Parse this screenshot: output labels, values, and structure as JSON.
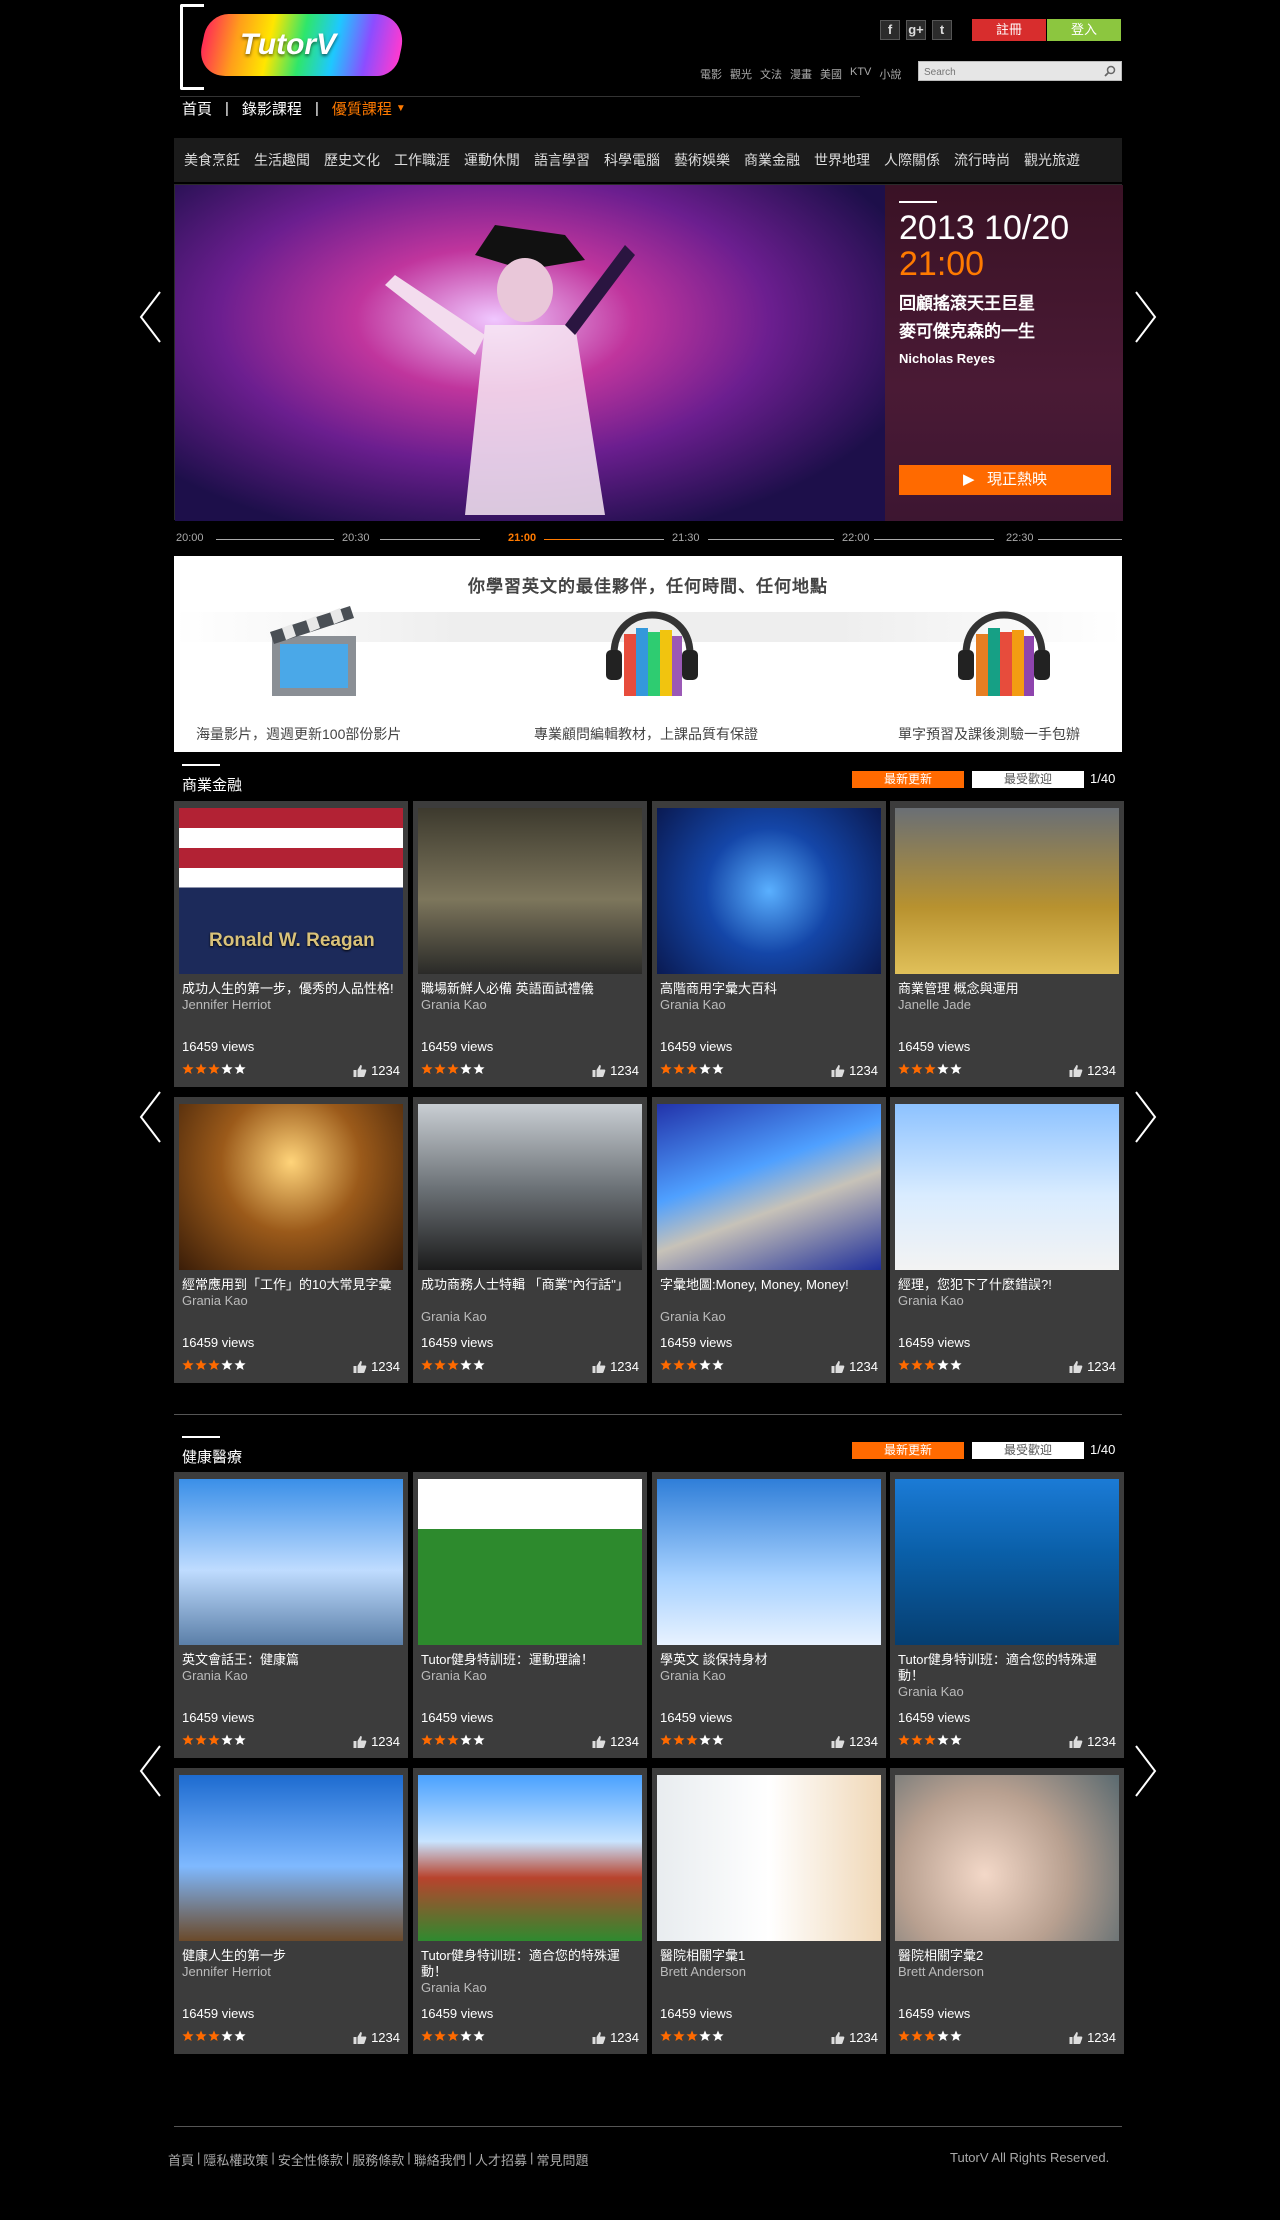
{
  "brand": {
    "logo_text": "TutorV"
  },
  "header": {
    "social": [
      "f",
      "g+",
      "t"
    ],
    "register_label": "註冊",
    "login_label": "登入",
    "quick_links": [
      "電影",
      "觀光",
      "文法",
      "漫畫",
      "美國",
      "KTV",
      "小說"
    ],
    "search_placeholder": "Search"
  },
  "nav": {
    "items": [
      "首頁",
      "錄影課程",
      "優質課程"
    ]
  },
  "categories": [
    "美食烹飪",
    "生活趣聞",
    "歷史文化",
    "工作職涯",
    "運動休閒",
    "語言學習",
    "科學電腦",
    "藝術娛樂",
    "商業金融",
    "世界地理",
    "人際關係",
    "流行時尚",
    "觀光旅遊"
  ],
  "hero": {
    "date": "2013 10/20",
    "time": "21:00",
    "title_line1": "回顧搖滾天王巨星",
    "title_line2": "麥可傑克森的一生",
    "author": "Nicholas Reyes",
    "play_label": "現正熱映"
  },
  "timeline": [
    "20:00",
    "20:30",
    "21:00",
    "21:30",
    "22:00",
    "22:30"
  ],
  "banner": {
    "headline": "你學習英文的最佳夥伴，任何時間、任何地點",
    "captions": [
      "海量影片，週週更新100部份影片",
      "專業顧問編輯教材，上課品質有保證",
      "單字預習及課後測驗一手包辦"
    ]
  },
  "sections": [
    {
      "title": "商業金融",
      "tab_new": "最新更新",
      "tab_popular": "最受歡迎",
      "pager": "1/40",
      "cards": [
        {
          "title": "成功人生的第一步，優秀的人品性格!",
          "author": "Jennifer Herriot",
          "views": "16459 views",
          "likes": "1234",
          "thumb_text": "Ronald W. Reagan"
        },
        {
          "title": "職場新鮮人必備 英語面試禮儀",
          "author": "Grania Kao",
          "views": "16459 views",
          "likes": "1234"
        },
        {
          "title": "高階商用字彙大百科",
          "author": "Grania Kao",
          "views": "16459 views",
          "likes": "1234"
        },
        {
          "title": "商業管理 概念與運用",
          "author": "Janelle Jade",
          "views": "16459 views",
          "likes": "1234"
        },
        {
          "title": "經常應用到「工作」的10大常見字彙",
          "author": "Grania Kao",
          "views": "16459 views",
          "likes": "1234"
        },
        {
          "title": "成功商務人士特輯 「商業\"內行話\"」",
          "author": "Grania Kao",
          "views": "16459 views",
          "likes": "1234"
        },
        {
          "title": "字彙地圖:Money, Money, Money!",
          "author": "Grania Kao",
          "views": "16459 views",
          "likes": "1234"
        },
        {
          "title": "經理，您犯下了什麼錯誤?!",
          "author": "Grania Kao",
          "views": "16459 views",
          "likes": "1234"
        }
      ]
    },
    {
      "title": "健康醫療",
      "tab_new": "最新更新",
      "tab_popular": "最受歡迎",
      "pager": "1/40",
      "cards": [
        {
          "title": "英文會話王：健康篇",
          "author": "Grania Kao",
          "views": "16459 views",
          "likes": "1234"
        },
        {
          "title": "Tutor健身特訓班：運動理論！",
          "author": "Grania Kao",
          "views": "16459 views",
          "likes": "1234"
        },
        {
          "title": "學英文 談保持身材",
          "author": "Grania Kao",
          "views": "16459 views",
          "likes": "1234"
        },
        {
          "title": "Tutor健身特训班：適合您的特殊運動！",
          "author": "Grania Kao",
          "views": "16459 views",
          "likes": "1234"
        },
        {
          "title": "健康人生的第一步",
          "author": "Jennifer Herriot",
          "views": "16459 views",
          "likes": "1234"
        },
        {
          "title": "Tutor健身特训班：適合您的特殊運動！",
          "author": "Grania Kao",
          "views": "16459 views",
          "likes": "1234"
        },
        {
          "title": "醫院相關字彙1",
          "author": "Brett Anderson",
          "views": "16459 views",
          "likes": "1234"
        },
        {
          "title": "醫院相關字彙2",
          "author": "Brett Anderson",
          "views": "16459 views",
          "likes": "1234"
        }
      ]
    }
  ],
  "footer": {
    "links": [
      "首頁",
      "隱私權政策",
      "安全性條款",
      "服務條款",
      "聯絡我們",
      "人才招募",
      "常見問題"
    ],
    "copyright": "TutorV All Rights Reserved."
  },
  "colors": {
    "accent": "#ff6a00",
    "register": "#d82d2d",
    "login": "#8cc63f",
    "card_bg": "#3c3c3c"
  }
}
